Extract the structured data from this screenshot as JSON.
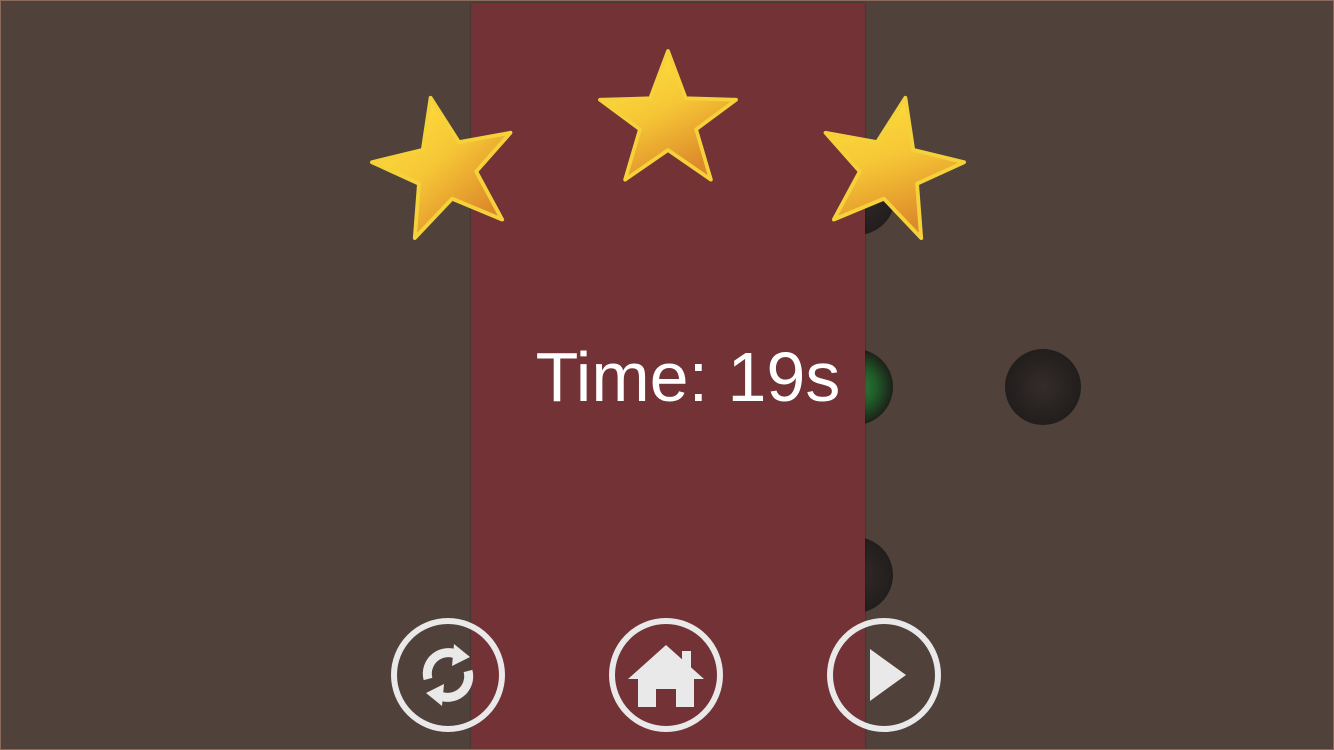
{
  "result": {
    "stars_earned": 3,
    "stars_total": 3,
    "time_text": "Time: 19s"
  },
  "board": {
    "holes": [
      {
        "name": "hole-top-right",
        "glow": false
      },
      {
        "name": "hole-middle-center",
        "glow": true
      },
      {
        "name": "hole-middle-far-right",
        "glow": false
      },
      {
        "name": "hole-bottom-right",
        "glow": false
      }
    ]
  },
  "buttons": {
    "restart_icon": "restart-icon",
    "home_icon": "home-icon",
    "next_icon": "play-icon"
  },
  "colors": {
    "background": "#50423b",
    "panel": "#733235",
    "star_top": "#ffe23a",
    "star_bottom": "#e0902a",
    "button_outline": "#e9e9e9",
    "text": "#ffffff"
  }
}
